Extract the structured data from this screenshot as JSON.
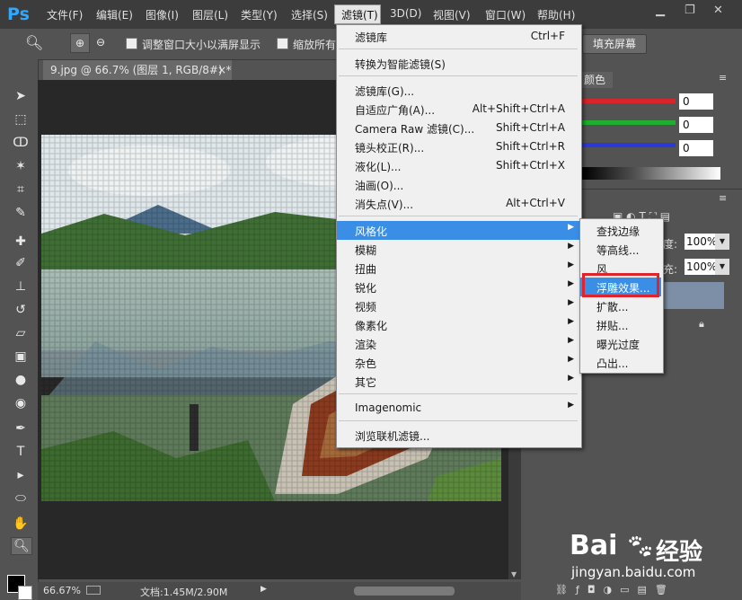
{
  "app": {
    "logo": "Ps"
  },
  "menubar": {
    "items": [
      "文件(F)",
      "编辑(E)",
      "图像(I)",
      "图层(L)",
      "类型(Y)",
      "选择(S)",
      "滤镜(T)",
      "3D(D)",
      "视图(V)",
      "窗口(W)",
      "帮助(H)"
    ]
  },
  "options": {
    "resize_windows": "调整窗口大小以满屏显示",
    "zoom_all": "缩放所有",
    "fill_screen": "填充屏幕"
  },
  "document": {
    "tab_title": "9.jpg @ 66.7% (图层 1, RGB/8#) *",
    "tab_close": "×"
  },
  "status": {
    "zoom": "66.67%",
    "doc_info": "文档:1.45M/2.90M"
  },
  "color_panel": {
    "tab": "颜色",
    "r": "0",
    "g": "0",
    "b": "0"
  },
  "layers_panel": {
    "opacity_label": "度:",
    "opacity": "100%",
    "fill_label": "充:",
    "fill": "100%"
  },
  "filter_menu": {
    "last_filter": {
      "label": "滤镜库",
      "shortcut": "Ctrl+F"
    },
    "smart_filters": "转换为智能滤镜(S)",
    "group1": [
      {
        "label": "滤镜库(G)...",
        "shortcut": ""
      },
      {
        "label": "自适应广角(A)...",
        "shortcut": "Alt+Shift+Ctrl+A"
      },
      {
        "label": "Camera Raw 滤镜(C)...",
        "shortcut": "Shift+Ctrl+A"
      },
      {
        "label": "镜头校正(R)...",
        "shortcut": "Shift+Ctrl+R"
      },
      {
        "label": "液化(L)...",
        "shortcut": "Shift+Ctrl+X"
      },
      {
        "label": "油画(O)...",
        "shortcut": ""
      },
      {
        "label": "消失点(V)...",
        "shortcut": "Alt+Ctrl+V"
      }
    ],
    "group2": [
      "风格化",
      "模糊",
      "扭曲",
      "锐化",
      "视频",
      "像素化",
      "渲染",
      "杂色",
      "其它"
    ],
    "imagenomic": "Imagenomic",
    "browse": "浏览联机滤镜..."
  },
  "stylize_submenu": [
    "查找边缘",
    "等高线...",
    "风",
    "浮雕效果...",
    "扩散...",
    "拼贴...",
    "曝光过度",
    "凸出..."
  ],
  "watermark": {
    "brand_left": "Bai",
    "brand_right": "经验",
    "url": "jingyan.baidu.com"
  },
  "colors": {
    "highlight": "#3a8ee6",
    "callout_red": "#e0242b",
    "ps_blue": "#31a8ff"
  }
}
